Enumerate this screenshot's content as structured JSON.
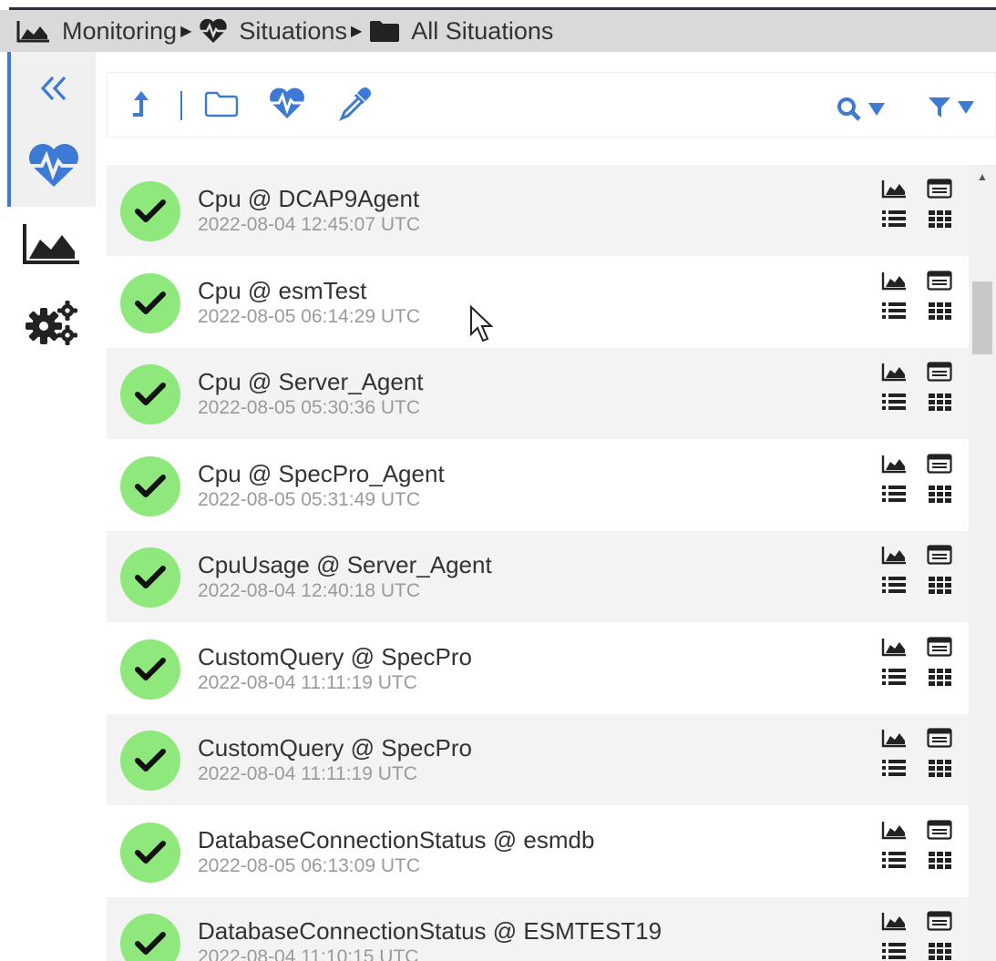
{
  "breadcrumb": [
    {
      "label": "Monitoring",
      "icon": "chart-area-icon"
    },
    {
      "label": "Situations",
      "icon": "heartbeat-icon"
    },
    {
      "label": "All Situations",
      "icon": "folder-icon"
    }
  ],
  "colors": {
    "accent": "#3d7ad6",
    "status_ok": "#8ee87c",
    "breadcrumb_bg": "#d9d9d9",
    "row_alt_bg": "#f3f3f3"
  },
  "situations": [
    {
      "title": "Cpu @ DCAP9Agent",
      "time": "2022-08-04 12:45:07 UTC"
    },
    {
      "title": "Cpu @ esmTest",
      "time": "2022-08-05 06:14:29 UTC"
    },
    {
      "title": "Cpu @ Server_Agent",
      "time": "2022-08-05 05:30:36 UTC"
    },
    {
      "title": "Cpu @ SpecPro_Agent",
      "time": "2022-08-05 05:31:49 UTC"
    },
    {
      "title": "CpuUsage @ Server_Agent",
      "time": "2022-08-04 12:40:18 UTC"
    },
    {
      "title": "CustomQuery @ SpecPro",
      "time": "2022-08-04 11:11:19 UTC"
    },
    {
      "title": "CustomQuery @ SpecPro",
      "time": "2022-08-04 11:11:19 UTC"
    },
    {
      "title": "DatabaseConnectionStatus @ esmdb",
      "time": "2022-08-05 06:13:09 UTC"
    },
    {
      "title": "DatabaseConnectionStatus @ ESMTEST19",
      "time": "2022-08-04 11:10:15 UTC"
    }
  ]
}
